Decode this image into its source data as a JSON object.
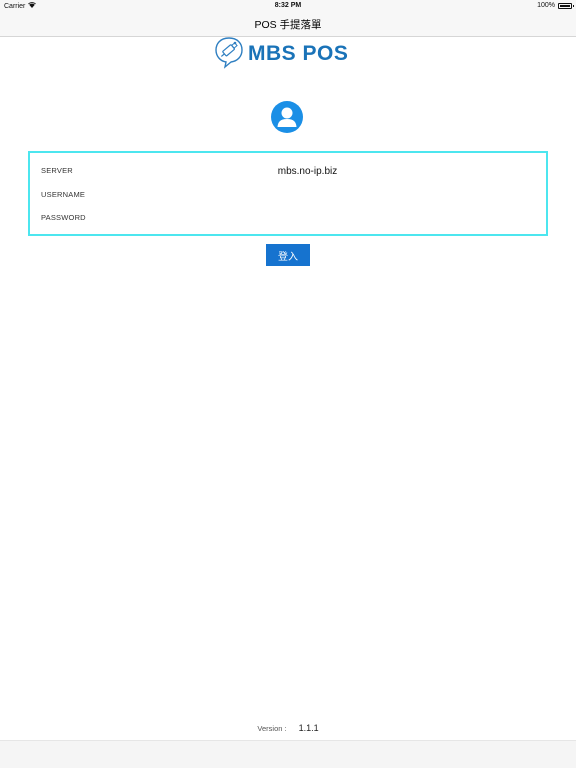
{
  "status_bar": {
    "carrier": "Carrier",
    "time": "8:32 PM",
    "battery": "100%"
  },
  "nav": {
    "title": "POS 手提落單"
  },
  "logo": {
    "text": "MBS POS",
    "icon": "chat-bubble-usb-icon"
  },
  "avatar": {
    "icon": "user-avatar-icon"
  },
  "form": {
    "server_label": "SERVER",
    "server_value": "mbs.no-ip.biz",
    "username_label": "USERNAME",
    "username_value": "",
    "password_label": "PASSWORD",
    "password_value": ""
  },
  "login_button": {
    "label": "登入"
  },
  "footer": {
    "version_label": "Version :",
    "version_value": "1.1.1"
  },
  "colors": {
    "accent": "#1673cf",
    "logo": "#1a73b8",
    "avatar": "#1b8fe6",
    "form_border": "#4ce6ef"
  }
}
